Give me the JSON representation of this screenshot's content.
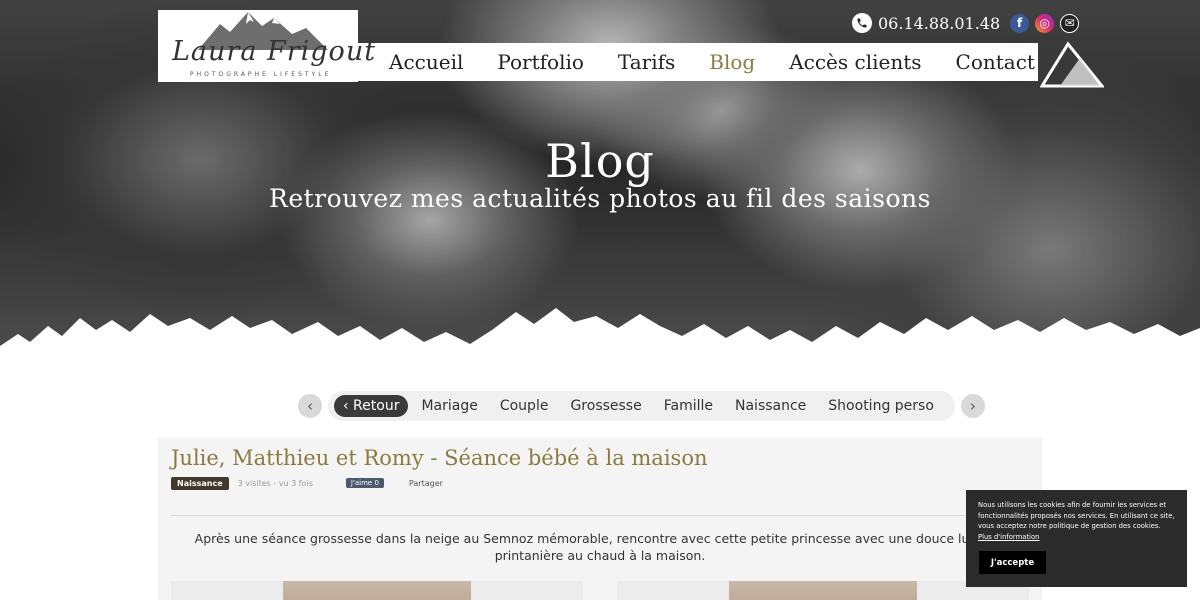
{
  "header": {
    "phone": "06.14.88.01.48",
    "logo": {
      "name": "Laura Frigout",
      "tagline": "PHOTOGRAPHE LIFESTYLE"
    },
    "nav": [
      {
        "label": "Accueil",
        "active": false
      },
      {
        "label": "Portfolio",
        "active": false
      },
      {
        "label": "Tarifs",
        "active": false
      },
      {
        "label": "Blog",
        "active": true
      },
      {
        "label": "Accès clients",
        "active": false
      },
      {
        "label": "Contact",
        "active": false
      }
    ],
    "social": [
      {
        "icon": "facebook-icon",
        "glyph": "f",
        "color": "#3b5998"
      },
      {
        "icon": "instagram-icon",
        "glyph": "◎",
        "color": "#d62976"
      },
      {
        "icon": "mail-icon",
        "glyph": "✉",
        "color": "#222222"
      }
    ]
  },
  "hero": {
    "title": "Blog",
    "subtitle": "Retrouvez mes actualités photos au fil des saisons"
  },
  "filters": {
    "prev": "‹",
    "next": "›",
    "items": [
      "‹ Retour",
      "Mariage",
      "Couple",
      "Grossesse",
      "Famille",
      "Naissance",
      "Shooting perso"
    ]
  },
  "article": {
    "title": "Julie, Matthieu et Romy - Séance bébé à la maison",
    "category": "Naissance",
    "visits": "3 visites - vu 3 fois",
    "like": "J'aime 0",
    "share": "Partager",
    "text": "Après une séance grossesse dans la neige au Semnoz mémorable, rencontre avec cette petite princesse avec une douce lumière printanière au chaud à la maison."
  },
  "cookie": {
    "text": "Nous utilisons les cookies afin de fournir les services et fonctionnalités proposés nos services. En utilisant ce site, vous acceptez notre politique de gestion des cookies.",
    "link": "Plus d'information",
    "button": "J'accepte"
  },
  "colors": {
    "accent": "#8a7a3f",
    "cookie_bg": "#2b2b2b"
  }
}
